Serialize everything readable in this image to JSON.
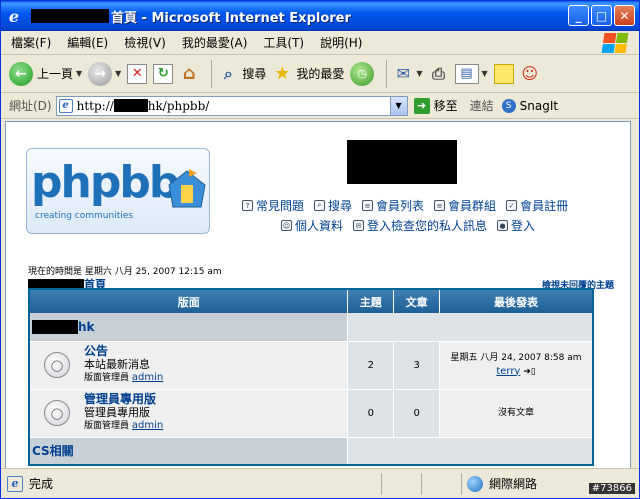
{
  "window": {
    "title": "首頁 - Microsoft Internet Explorer"
  },
  "menu": [
    "檔案(F)",
    "編輯(E)",
    "檢視(V)",
    "我的最愛(A)",
    "工具(T)",
    "說明(H)"
  ],
  "toolbar": {
    "back": "上一頁",
    "search": "搜尋",
    "favorites": "我的最愛"
  },
  "address": {
    "label": "網址(D)",
    "url_prefix": "http://",
    "url_suffix": "hk/phpbb/",
    "go": "移至",
    "links": "連結",
    "snagit": "SnagIt"
  },
  "logo": {
    "word": "phpbb",
    "sub": "creating communities"
  },
  "nav": {
    "row1": [
      "常見問題",
      "搜尋",
      "會員列表",
      "會員群組",
      "會員註冊"
    ],
    "row2": [
      "個人資料",
      "登入檢查您的私人訊息",
      "登入"
    ]
  },
  "forum": {
    "time_line": "現在的時間是 星期六 八月 25, 2007 12:15 am",
    "crumb": "首頁",
    "unanswered": "檢視未回覆的主題",
    "headers": [
      "版面",
      "主題",
      "文章",
      "最後發表"
    ],
    "category1": "hk",
    "rows": [
      {
        "name": "公告",
        "desc": "本站最新消息",
        "mod_label": "版面管理員",
        "mod": "admin",
        "topics": "2",
        "posts": "3",
        "last": "星期五 八月 24, 2007 8:58 am",
        "last_user": "terry"
      },
      {
        "name": "管理員專用版",
        "desc": "管理員專用版",
        "mod_label": "版面管理員",
        "mod": "admin",
        "topics": "0",
        "posts": "0",
        "last": "沒有文章",
        "last_user": ""
      }
    ],
    "category2": "CS相關"
  },
  "status": {
    "text": "完成",
    "zone": "網際網路",
    "watermark": "#73866"
  }
}
